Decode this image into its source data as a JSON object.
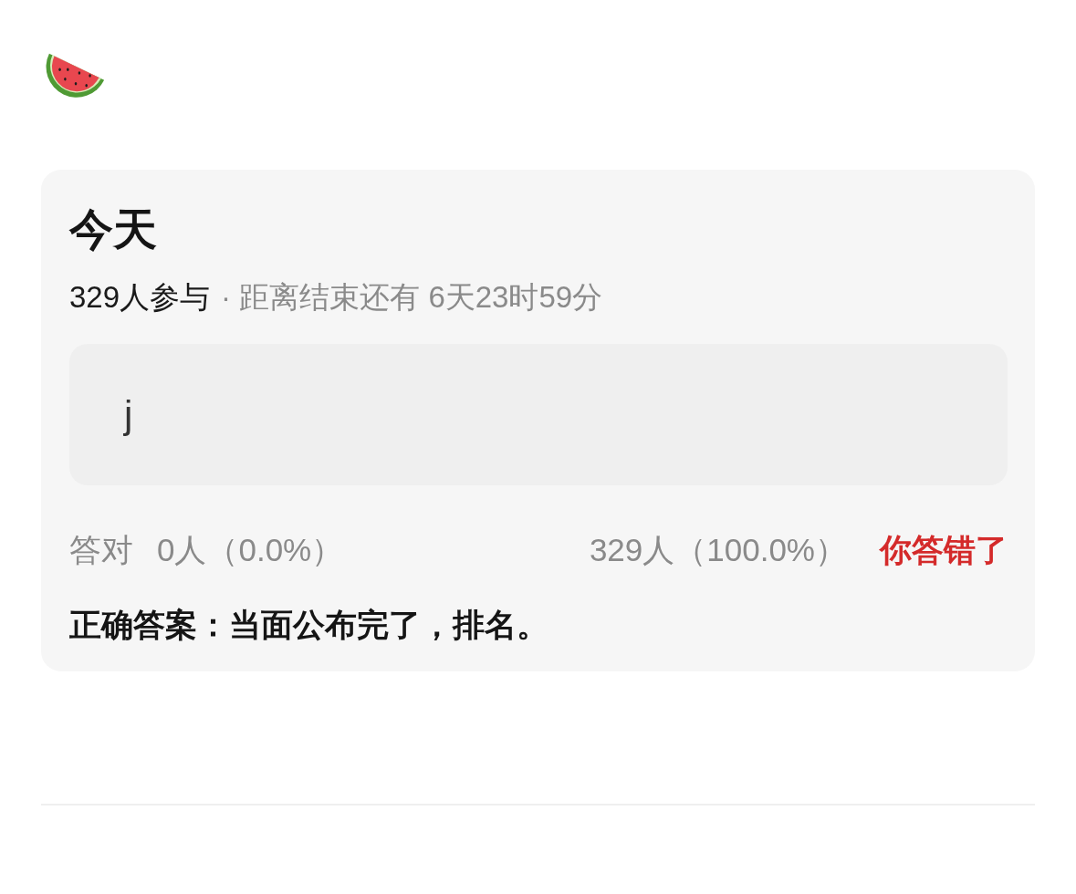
{
  "card": {
    "title": "今天",
    "participants": "329人参与",
    "countdown": "· 距离结束还有 6天23时59分",
    "answer": {
      "value": "j"
    },
    "stats": {
      "correct_label": "答对",
      "correct_count": "0人（0.0%）",
      "wrong_count": "329人（100.0%）"
    },
    "verdict": {
      "text": "你答错了",
      "correct": false
    },
    "correct_answer": "正确答案：当面公布完了，排名。"
  }
}
